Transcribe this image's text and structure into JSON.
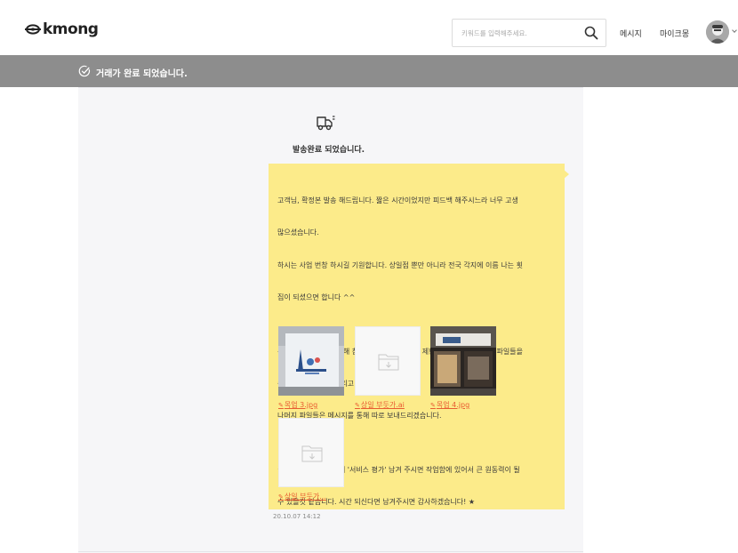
{
  "header": {
    "logo_text": "kmong",
    "search_placeholder": "키워드를 입력해주세요.",
    "nav_message": "메시지",
    "nav_mykmong": "마이크몽"
  },
  "banner": {
    "text": "거래가 완료 되었습니다."
  },
  "chat": {
    "status_title": "발송완료 되었습니다.",
    "message_lines": [
      "고객님, 확정본 발송 해드립니다. 짧은 시간이었지만 피드백 해주시느라 너무 고생",
      "많으셨습니다.",
      "하시는 사업 번창 하시길 기원합니다. 상일점 뿐만 아니라 전국 각지에 이름 나는 횟",
      "집이 되셨으면 합니다 ^^",
      "",
      "우선 발송 메시지를 통해 첨부 할 수 있는 파일이 제한이 되어 중요한 원본 파일들을",
      "중심으로 먼저 보내드리고",
      "나머지 파일들은 메시지를 통해 따로 보내드리겠습니다.",
      "",
      "★ 구매 확정 전 하단에 '서비스 평가' 남겨 주시면 작업함에 있어서 큰 원동력이 될",
      "수 있을것 같습니다. 시간 되신다면 남겨주시면 감사하겠습니다! ★"
    ],
    "attachments": [
      {
        "name": "목업 3.jpg",
        "type": "image"
      },
      {
        "name": "상일 부둣가.ai",
        "type": "file"
      },
      {
        "name": "목업 4.jpg",
        "type": "image"
      },
      {
        "name": "상일 부둣가...",
        "type": "file"
      }
    ],
    "timestamp": "20.10.07 14:12"
  },
  "colors": {
    "banner_bg": "#8d8d8d",
    "bubble_bg": "#fceb8a",
    "link": "#e85c32"
  }
}
